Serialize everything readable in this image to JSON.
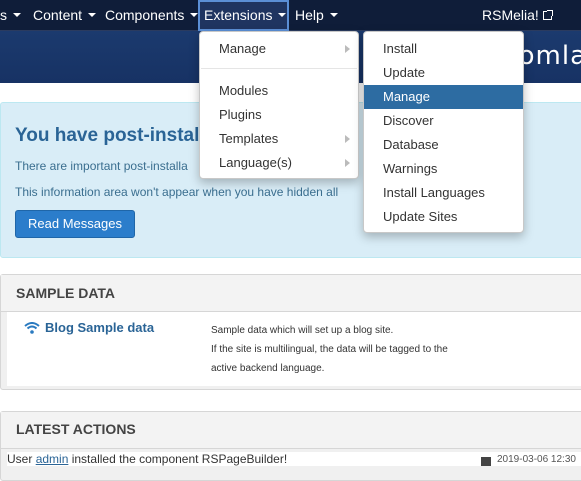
{
  "navbar": {
    "items": [
      {
        "label": "s"
      },
      {
        "label": "Content"
      },
      {
        "label": "Components"
      },
      {
        "label": "Extensions"
      },
      {
        "label": "Help"
      }
    ],
    "user": "RSMelia!"
  },
  "header": {
    "logo_fragment": "omla"
  },
  "alert": {
    "title": "You have post-installa",
    "line1": "There are important post-installa",
    "line2": "This information area won't appear when you have hidden all",
    "button": "Read Messages"
  },
  "sample_data": {
    "heading": "SAMPLE DATA",
    "item_title": "Blog Sample data",
    "desc_line1": "Sample data which will set up a blog site.",
    "desc_line2": "If the site is multilingual, the data will be tagged to the",
    "desc_line3": "active backend language."
  },
  "latest_actions": {
    "heading": "LATEST ACTIONS",
    "prefix": "User",
    "user_link": "admin",
    "suffix": "installed the component RSPageBuilder!",
    "date": "2019-03-06 12:30"
  },
  "extensions_menu": {
    "items": [
      "Manage",
      "Modules",
      "Plugins",
      "Templates",
      "Language(s)"
    ]
  },
  "manage_submenu": {
    "items": [
      "Install",
      "Update",
      "Manage",
      "Discover",
      "Database",
      "Warnings",
      "Install Languages",
      "Update Sites"
    ],
    "selected": "Manage"
  },
  "colors": {
    "navbar": "#0f1d39",
    "accent": "#2d6ca2",
    "alert_bg": "#d9edf7"
  }
}
